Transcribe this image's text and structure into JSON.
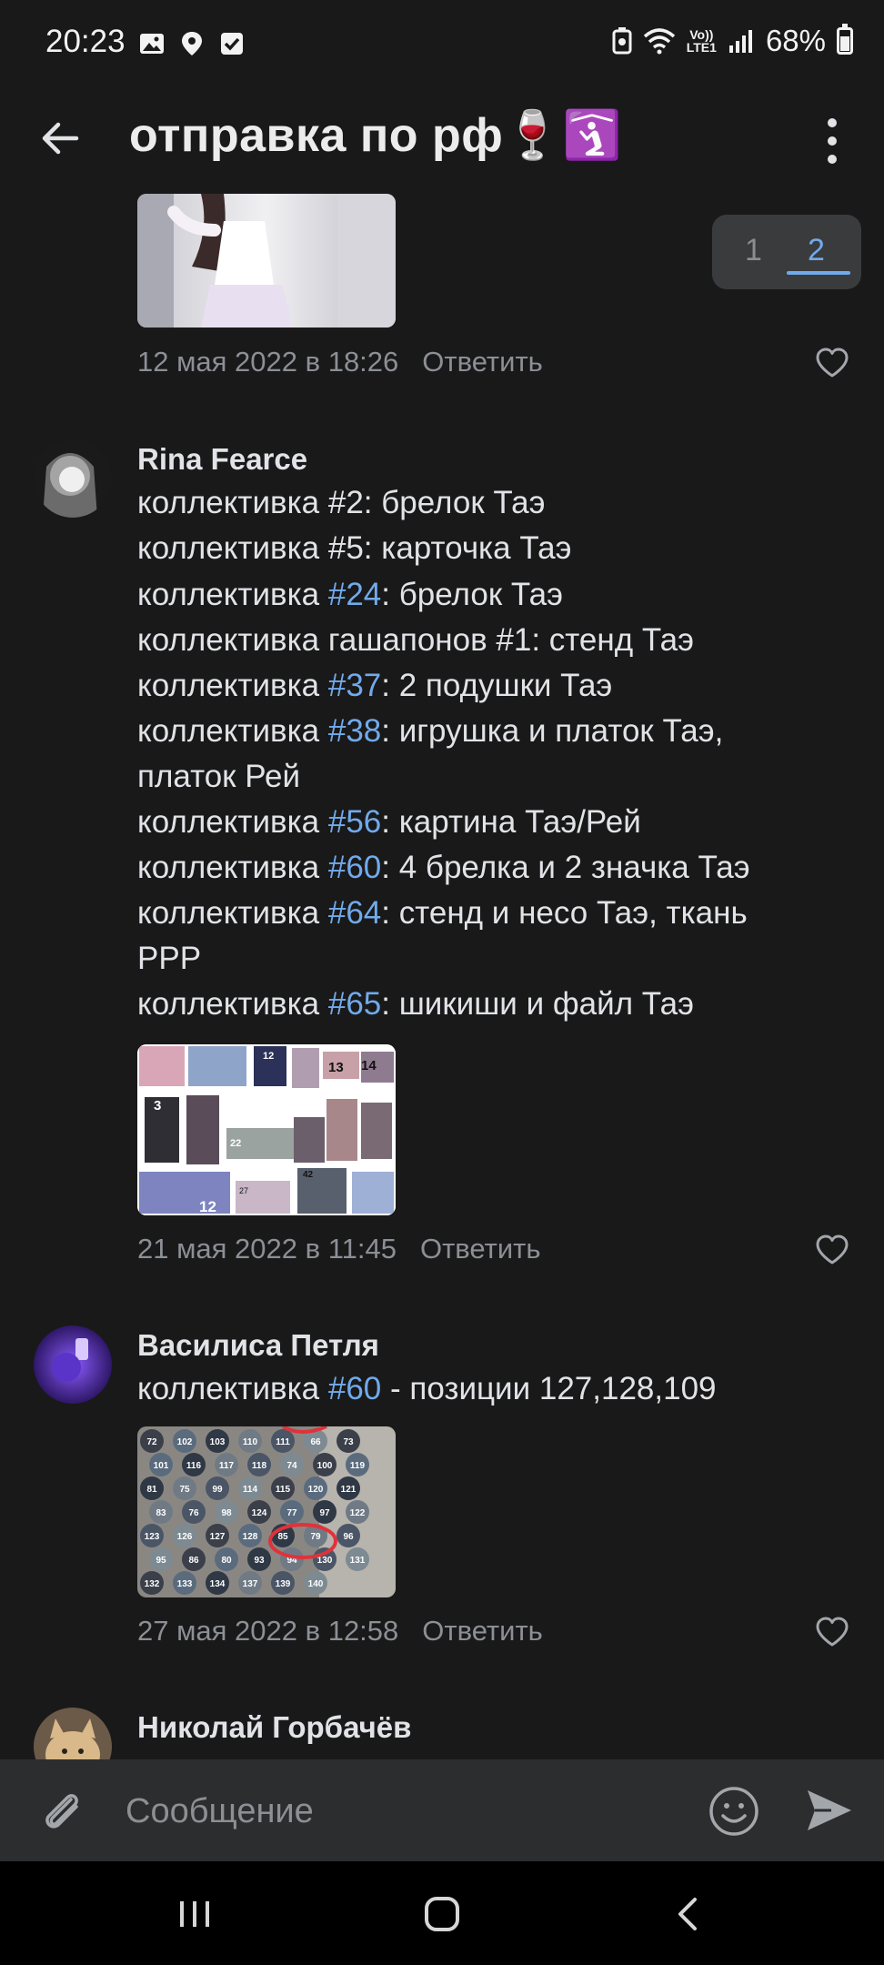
{
  "status_bar": {
    "time": "20:23",
    "network": "LTE1",
    "volte": "Vo))",
    "battery": "68%"
  },
  "header": {
    "title": "отправка по рф🍷🛐"
  },
  "pager": {
    "pages": [
      "1",
      "2"
    ],
    "active": "2"
  },
  "comments": [
    {
      "timestamp": "12 мая 2022 в 18:26",
      "reply": "Ответить"
    },
    {
      "author": "Rina Fearce",
      "lines": [
        {
          "pre": "коллективка #2: брелок Таэ",
          "tag": "",
          "post": ""
        },
        {
          "pre": "коллективка #5: карточка Таэ",
          "tag": "",
          "post": ""
        },
        {
          "pre": "коллективка ",
          "tag": "#24",
          "post": ": брелок Таэ"
        },
        {
          "pre": "коллективка гашапонов #1: стенд Таэ",
          "tag": "",
          "post": ""
        },
        {
          "pre": "коллективка ",
          "tag": "#37",
          "post": ": 2 подушки Таэ"
        },
        {
          "pre": "коллективка ",
          "tag": "#38",
          "post": ": игрушка и платок Таэ,"
        },
        {
          "pre": "платок Рей",
          "tag": "",
          "post": ""
        },
        {
          "pre": "коллективка ",
          "tag": "#56",
          "post": ": картина Таэ/Рей"
        },
        {
          "pre": "коллективка ",
          "tag": "#60",
          "post": ": 4 брелка и 2 значка Таэ"
        },
        {
          "pre": "коллективка ",
          "tag": "#64",
          "post": ": стенд и несо Таэ, ткань"
        },
        {
          "pre": "РРР",
          "tag": "",
          "post": ""
        },
        {
          "pre": "коллективка ",
          "tag": "#65",
          "post": ": шикиши и файл Таэ"
        }
      ],
      "image_numbers": [
        "12",
        "13",
        "14",
        "3",
        "22",
        "42",
        "27",
        "12"
      ],
      "timestamp": "21 мая 2022 в 11:45",
      "reply": "Ответить"
    },
    {
      "author": "Василиса Петля",
      "lines": [
        {
          "pre": "коллективка ",
          "tag": "#60",
          "post": " - позиции 127,128,109"
        }
      ],
      "image_numbers": [
        "72",
        "102",
        "103",
        "110",
        "111",
        "66",
        "73",
        "101",
        "116",
        "117",
        "118",
        "74",
        "100",
        "119",
        "81",
        "75",
        "99",
        "114",
        "115",
        "120",
        "121",
        "83",
        "76",
        "98",
        "124",
        "77",
        "97",
        "122",
        "123",
        "126",
        "127",
        "128",
        "85",
        "79",
        "96",
        "95",
        "86",
        "80",
        "93",
        "94",
        "130",
        "131",
        "132",
        "133",
        "134",
        "137",
        "139",
        "140"
      ],
      "timestamp": "27 мая 2022 в 12:58",
      "reply": "Ответить"
    },
    {
      "author": "Николай Горбачёв"
    }
  ],
  "composer": {
    "placeholder": "Сообщение"
  },
  "colors": {
    "background": "#19191a",
    "accent": "#71aaeb",
    "muted": "#8c8f94",
    "composer": "#2c2d2e"
  },
  "icons": [
    "back-arrow-icon",
    "more-vertical-icon",
    "heart-icon",
    "paperclip-icon",
    "smile-icon",
    "send-icon",
    "recents-icon",
    "home-icon",
    "nav-back-icon"
  ]
}
